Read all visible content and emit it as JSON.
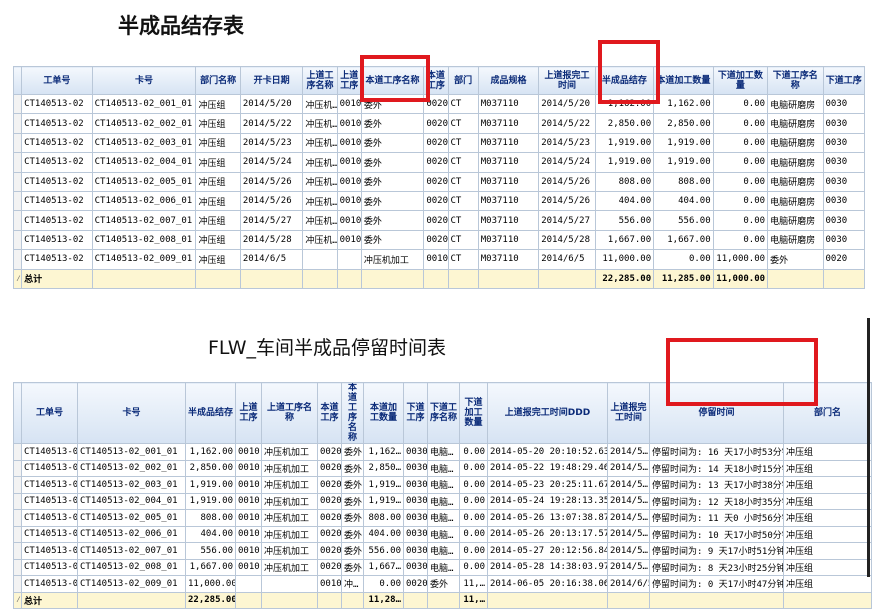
{
  "table1": {
    "title": "半成品结存表",
    "headers": [
      "工单号",
      "卡号",
      "部门名称",
      "开卡日期",
      "上道工序名称",
      "上道工序",
      "本道工序名称",
      "本道工序",
      "部门",
      "成品规格",
      "上道报完工时间",
      "半成品结存",
      "本道加工数量",
      "下道加工数量",
      "下道工序名称",
      "下道工序"
    ],
    "rows": [
      [
        "CT140513-02",
        "CT140513-02_001_01",
        "冲压组",
        "2014/5/20",
        "冲压机…",
        "0010",
        "委外",
        "0020",
        "CT",
        "M037110",
        "2014/5/20",
        "1,162.00",
        "1,162.00",
        "0.00",
        "电脑研磨房",
        "0030"
      ],
      [
        "CT140513-02",
        "CT140513-02_002_01",
        "冲压组",
        "2014/5/22",
        "冲压机…",
        "0010",
        "委外",
        "0020",
        "CT",
        "M037110",
        "2014/5/22",
        "2,850.00",
        "2,850.00",
        "0.00",
        "电脑研磨房",
        "0030"
      ],
      [
        "CT140513-02",
        "CT140513-02_003_01",
        "冲压组",
        "2014/5/23",
        "冲压机…",
        "0010",
        "委外",
        "0020",
        "CT",
        "M037110",
        "2014/5/23",
        "1,919.00",
        "1,919.00",
        "0.00",
        "电脑研磨房",
        "0030"
      ],
      [
        "CT140513-02",
        "CT140513-02_004_01",
        "冲压组",
        "2014/5/24",
        "冲压机…",
        "0010",
        "委外",
        "0020",
        "CT",
        "M037110",
        "2014/5/24",
        "1,919.00",
        "1,919.00",
        "0.00",
        "电脑研磨房",
        "0030"
      ],
      [
        "CT140513-02",
        "CT140513-02_005_01",
        "冲压组",
        "2014/5/26",
        "冲压机…",
        "0010",
        "委外",
        "0020",
        "CT",
        "M037110",
        "2014/5/26",
        "808.00",
        "808.00",
        "0.00",
        "电脑研磨房",
        "0030"
      ],
      [
        "CT140513-02",
        "CT140513-02_006_01",
        "冲压组",
        "2014/5/26",
        "冲压机…",
        "0010",
        "委外",
        "0020",
        "CT",
        "M037110",
        "2014/5/26",
        "404.00",
        "404.00",
        "0.00",
        "电脑研磨房",
        "0030"
      ],
      [
        "CT140513-02",
        "CT140513-02_007_01",
        "冲压组",
        "2014/5/27",
        "冲压机…",
        "0010",
        "委外",
        "0020",
        "CT",
        "M037110",
        "2014/5/27",
        "556.00",
        "556.00",
        "0.00",
        "电脑研磨房",
        "0030"
      ],
      [
        "CT140513-02",
        "CT140513-02_008_01",
        "冲压组",
        "2014/5/28",
        "冲压机…",
        "0010",
        "委外",
        "0020",
        "CT",
        "M037110",
        "2014/5/28",
        "1,667.00",
        "1,667.00",
        "0.00",
        "电脑研磨房",
        "0030"
      ],
      [
        "CT140513-02",
        "CT140513-02_009_01",
        "冲压组",
        "2014/6/5",
        "",
        "",
        "冲压机加工",
        "0010",
        "CT",
        "M037110",
        "2014/6/5",
        "11,000.00",
        "0.00",
        "11,000.00",
        "委外",
        "0020"
      ]
    ],
    "total_label": "总计",
    "totals": [
      "",
      "",
      "",
      "",
      "",
      "",
      "",
      "",
      "",
      "",
      "",
      "22,285.00",
      "11,285.00",
      "11,000.00",
      "",
      ""
    ]
  },
  "table2": {
    "title": "FLW_车间半成品停留时间表",
    "headers": [
      "工单号",
      "卡号",
      "半成品结存",
      "上道工序",
      "上道工序名称",
      "本道工序",
      "本道工序名称",
      "本道加工数量",
      "下道工序",
      "下道工序名称",
      "下道加工数量",
      "上道报完工时间DDD",
      "上道报完工时间",
      "停留时间",
      "部门名"
    ],
    "rows": [
      [
        "CT140513-02",
        "CT140513-02_001_01",
        "1,162.00",
        "0010",
        "冲压机加工",
        "0020",
        "委外",
        "1,162…",
        "0030",
        "电脑…",
        "0.00",
        "2014-05-20 20:10:52.630",
        "2014/5…",
        "停留时间为: 16  天17小时53分钟",
        "冲压组"
      ],
      [
        "CT140513-02",
        "CT140513-02_002_01",
        "2,850.00",
        "0010",
        "冲压机加工",
        "0020",
        "委外",
        "2,850…",
        "0030",
        "电脑…",
        "0.00",
        "2014-05-22 19:48:29.460",
        "2014/5…",
        "停留时间为: 14  天18小时15分钟",
        "冲压组"
      ],
      [
        "CT140513-02",
        "CT140513-02_003_01",
        "1,919.00",
        "0010",
        "冲压机加工",
        "0020",
        "委外",
        "1,919…",
        "0030",
        "电脑…",
        "0.00",
        "2014-05-23 20:25:11.670",
        "2014/5…",
        "停留时间为: 13  天17小时38分钟",
        "冲压组"
      ],
      [
        "CT140513-02",
        "CT140513-02_004_01",
        "1,919.00",
        "0010",
        "冲压机加工",
        "0020",
        "委外",
        "1,919…",
        "0030",
        "电脑…",
        "0.00",
        "2014-05-24 19:28:13.357",
        "2014/5…",
        "停留时间为: 12  天18小时35分钟",
        "冲压组"
      ],
      [
        "CT140513-02",
        "CT140513-02_005_01",
        "808.00",
        "0010",
        "冲压机加工",
        "0020",
        "委外",
        "808.00",
        "0030",
        "电脑…",
        "0.00",
        "2014-05-26 13:07:38.870",
        "2014/5…",
        "停留时间为: 11  天0 小时56分钟",
        "冲压组"
      ],
      [
        "CT140513-02",
        "CT140513-02_006_01",
        "404.00",
        "0010",
        "冲压机加工",
        "0020",
        "委外",
        "404.00",
        "0030",
        "电脑…",
        "0.00",
        "2014-05-26 20:13:17.577",
        "2014/5…",
        "停留时间为: 10  天17小时50分钟",
        "冲压组"
      ],
      [
        "CT140513-02",
        "CT140513-02_007_01",
        "556.00",
        "0010",
        "冲压机加工",
        "0020",
        "委外",
        "556.00",
        "0030",
        "电脑…",
        "0.00",
        "2014-05-27 20:12:56.840",
        "2014/5…",
        "停留时间为: 9   天17小时51分钟",
        "冲压组"
      ],
      [
        "CT140513-02",
        "CT140513-02_008_01",
        "1,667.00",
        "0010",
        "冲压机加工",
        "0020",
        "委外",
        "1,667…",
        "0030",
        "电脑…",
        "0.00",
        "2014-05-28 14:38:03.973",
        "2014/5…",
        "停留时间为: 8   天23小时25分钟",
        "冲压组"
      ],
      [
        "CT140513-02",
        "CT140513-02_009_01",
        "11,000.00",
        "",
        "",
        "0010",
        "冲…",
        "0.00",
        "0020",
        "委外",
        "11,…",
        "2014-06-05 20:16:38.063",
        "2014/6/5",
        "停留时间为: 0   天17小时47分钟",
        "冲压组"
      ]
    ],
    "total_label": "总计",
    "totals": [
      "",
      "",
      "22,285.00",
      "",
      "",
      "",
      "",
      "11,28…",
      "",
      "",
      "11,…",
      "",
      "",
      "",
      ""
    ]
  }
}
